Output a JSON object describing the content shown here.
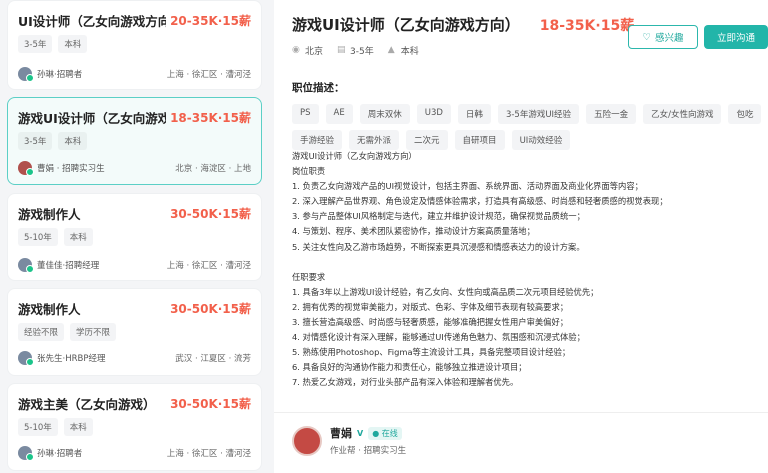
{
  "jobs": [
    {
      "title": "UI设计师（乙女向游戏方向）",
      "salary": "20-35K·15薪",
      "tags": [
        "3-5年",
        "本科"
      ],
      "recruiter": "孙琳·招聘者",
      "location": "上海 · 徐汇区 · 漕河泾"
    },
    {
      "title": "游戏UI设计师（乙女向游戏方...",
      "salary": "18-35K·15薪",
      "tags": [
        "3-5年",
        "本科"
      ],
      "recruiter": "曹娟 · 招聘实习生",
      "location": "北京 · 海淀区 · 上地"
    },
    {
      "title": "游戏制作人",
      "salary": "30-50K·15薪",
      "tags": [
        "5-10年",
        "本科"
      ],
      "recruiter": "董佳佳·招聘经理",
      "location": "上海 · 徐汇区 · 漕河泾"
    },
    {
      "title": "游戏制作人",
      "salary": "30-50K·15薪",
      "tags": [
        "经验不限",
        "学历不限"
      ],
      "recruiter": "张先生·HRBP经理",
      "location": "武汉 · 江夏区 · 流芳"
    },
    {
      "title": "游戏主美（乙女向游戏）",
      "salary": "30-50K·15薪",
      "tags": [
        "5-10年",
        "本科"
      ],
      "recruiter": "孙琳·招聘者",
      "location": "上海 · 徐汇区 · 漕河泾"
    }
  ],
  "detail": {
    "title": "游戏UI设计师（乙女向游戏方向）",
    "salary": "18-35K·15薪",
    "city": "北京",
    "experience": "3-5年",
    "education": "本科",
    "interest_label": "感兴趣",
    "chat_label": "立即沟通",
    "section_title": "职位描述：",
    "keywords": [
      "PS",
      "AE",
      "周末双休",
      "U3D",
      "日韩",
      "3-5年游戏UI经验",
      "五险一金",
      "乙女/女性向游戏",
      "包吃",
      "手游经验",
      "无需外派",
      "二次元",
      "自研项目",
      "UI动效经验"
    ],
    "desc_title": "游戏UI设计师（乙女向游戏方向）",
    "duty_title": "岗位职责",
    "duties": [
      "1. 负责乙女向游戏产品的UI视觉设计，包括主界面、系统界面、活动界面及商业化界面等内容；",
      "2. 深入理解产品世界观、角色设定及情感体验需求，打造具有高级感、时尚感和轻奢质感的视觉表现；",
      "3. 参与产品整体UI风格制定与迭代，建立并维护设计规范，确保视觉品质统一；",
      "4. 与策划、程序、美术团队紧密协作，推动设计方案高质量落地；",
      "5. 关注女性向及乙游市场趋势，不断探索更具沉浸感和情感表达力的设计方案。"
    ],
    "req_title": "任职要求",
    "requirements": [
      "1. 具备3年以上游戏UI设计经验，有乙女向、女性向或高品质二次元项目经验优先；",
      "2. 拥有优秀的视觉审美能力，对版式、色彩、字体及细节表现有较高要求；",
      "3. 擅长营造高级感、时尚感与轻奢质感，能够准确把握女性用户审美偏好；",
      "4. 对情感化设计有深入理解，能够通过UI传递角色魅力、氛围感和沉浸式体验；",
      "5. 熟练使用Photoshop、Figma等主流设计工具，具备完整项目设计经验；",
      "6. 具备良好的沟通协作能力和责任心，能够独立推进设计项目；",
      "7. 热爱乙女游戏，对行业头部产品有深入体验和理解者优先。"
    ],
    "recruiter_name": "曹娟",
    "verified": "V",
    "online": "● 在线",
    "recruiter_sub": "作业帮 · 招聘实习生"
  },
  "colors": {
    "accent": "#22b5a9",
    "salary": "#f2604b"
  }
}
